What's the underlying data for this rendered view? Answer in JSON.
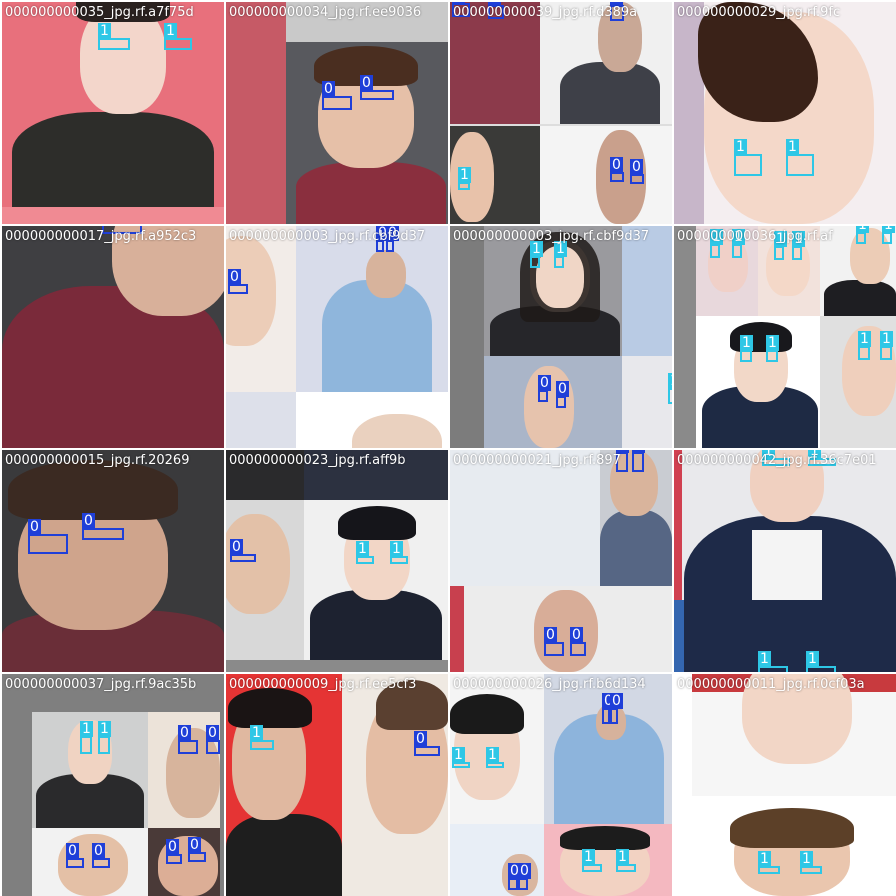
{
  "colors": {
    "class0": "#1f3fd8",
    "class1": "#2ec7e6",
    "label_text": "#ffffff",
    "filename_text": "#ffffff"
  },
  "tiles": [
    {
      "filename": "000000000035_jpg.rf.a7f75d",
      "labels": [
        "1",
        "1"
      ]
    },
    {
      "filename": "000000000034_jpg.rf.ee9036",
      "labels": [
        "0",
        "0"
      ]
    },
    {
      "filename": "000000000039_jpg.rf.d389a",
      "labels": [
        "0",
        "0",
        "0",
        "0",
        "0",
        "1"
      ]
    },
    {
      "filename": "000000000029_jpg.rf.9fc",
      "labels": [
        "1",
        "1"
      ]
    },
    {
      "filename": "000000000017_jpg.rf.a952c3",
      "labels": [
        "0",
        "0",
        "0",
        "0"
      ]
    },
    {
      "filename": "000000000003_jpg.rf.cbf9d37",
      "labels": [
        "1",
        "1",
        "0",
        "0",
        "1"
      ]
    },
    {
      "filename": "000000000036_jpg.rf.af",
      "labels": [
        "1",
        "1",
        "1",
        "1",
        "1",
        "1",
        "1",
        "1",
        "1",
        "1"
      ]
    },
    {
      "filename": "000000000015_jpg.rf.20269",
      "labels": [
        "0",
        "0"
      ]
    },
    {
      "filename": "000000000023_jpg.rf.aff9b",
      "labels": [
        "0",
        "1",
        "1"
      ]
    },
    {
      "filename": "000000000021_jpg.rf.897",
      "labels": [
        "0",
        "0",
        "0",
        "0"
      ]
    },
    {
      "filename": "000000000042_jpg.rf.36c7e01",
      "labels": [
        "1",
        "1"
      ]
    },
    {
      "filename": "000000000037_jpg.rf.9ac35b",
      "labels": [
        "1",
        "1",
        "0",
        "0",
        "0",
        "0",
        "0",
        "0"
      ]
    },
    {
      "filename": "000000000009_jpg.rf.ee5cf3",
      "labels": [
        "1",
        "0"
      ]
    },
    {
      "filename": "000000000026_jpg.rf.b6d134",
      "labels": [
        "0",
        "0",
        "1",
        "1",
        "0",
        "0"
      ]
    },
    {
      "filename": "000000000011_jpg.rf.0cf03a",
      "labels": [
        "1",
        "1",
        "1",
        "1"
      ]
    }
  ]
}
